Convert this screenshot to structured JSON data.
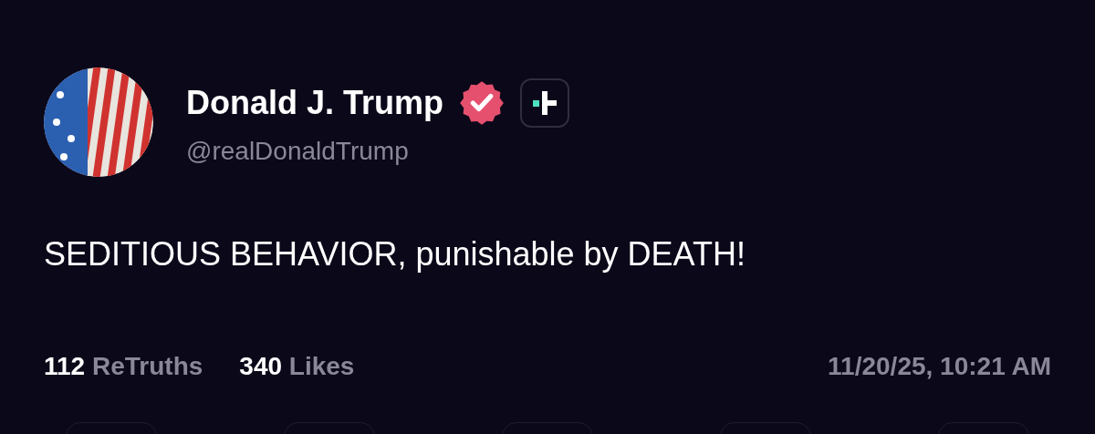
{
  "author": {
    "name": "Donald J. Trump",
    "verified": true,
    "handle": "@realDonaldTrump"
  },
  "post": {
    "text": "SEDITIOUS BEHAVIOR, punishable by DEATH!"
  },
  "stats": [
    {
      "count": "112",
      "label": "ReTruths"
    },
    {
      "count": "340",
      "label": "Likes"
    }
  ],
  "timestamp": "11/20/25, 10:21 AM"
}
